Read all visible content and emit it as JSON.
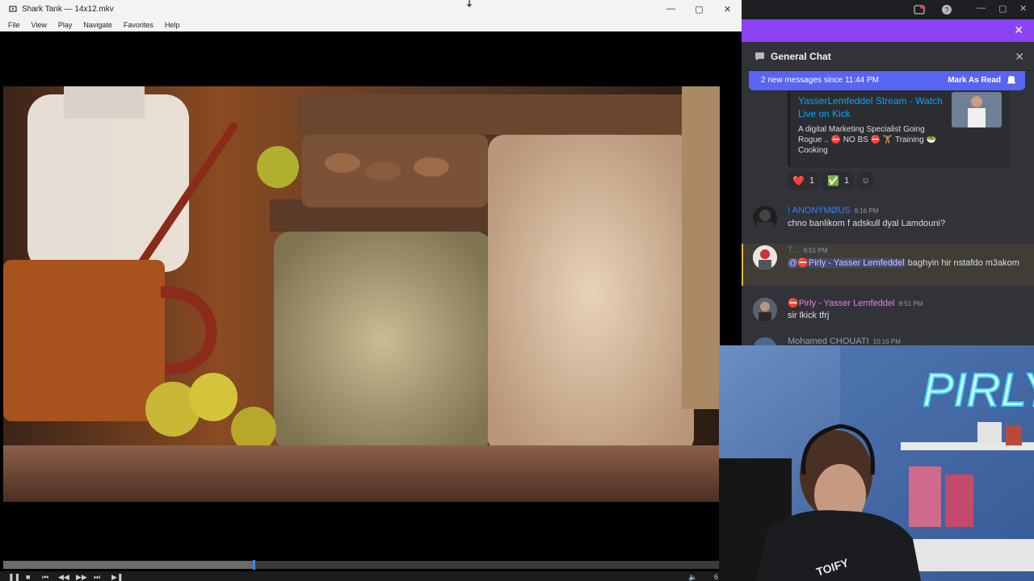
{
  "player": {
    "title": "Shark Tank — 14x12.mkv",
    "menu": [
      "File",
      "View",
      "Play",
      "Navigate",
      "Favorites",
      "Help"
    ],
    "window_buttons": {
      "minimize": "—",
      "maximize": "▢",
      "close": "✕"
    },
    "seek_progress": 0.35,
    "controls": {
      "pause": "❚❚",
      "stop": "■",
      "prev": "⏮",
      "rewind": "◀◀",
      "forward": "▶▶",
      "next": "⏭",
      "frame_step": "▶❚",
      "volume": "🔈",
      "volume_text": "6"
    }
  },
  "chat": {
    "banner_close": "✕",
    "header": {
      "title": "General Chat",
      "close": "✕"
    },
    "new_messages": {
      "text": "2 new messages since 11:44 PM",
      "action": "Mark As Read"
    },
    "embed": {
      "title": "YasserLemfeddel Stream - Watch Live on Kick",
      "description": "A digital Marketing Specialist Going Rogue .. ⛔ NO BS ⛔ 🏋 Training 🥗 Cooking"
    },
    "reactions": [
      {
        "glyph": "❤️",
        "count": "1"
      },
      {
        "glyph": "✅",
        "count": "1"
      },
      {
        "glyph": "☺",
        "count": ""
      }
    ],
    "messages": [
      {
        "author": "! ANONŸMØUS",
        "time": "9:16 PM",
        "text": "chno banlikom f adskull dyal Lamdouni?",
        "author_color": "#3b82f6"
      },
      {
        "author": "T...",
        "time": "9:51 PM",
        "mention": "@⛔Pirly - Yasser Lemfeddel",
        "text": " baghyin hir nstafdo m3akom",
        "author_color": "#6d6f78"
      },
      {
        "author": "⛔Pirly - Yasser Lemfeddel",
        "time": "9:51 PM",
        "text": "sir lkick tfrj",
        "author_color": "#e879f9"
      },
      {
        "author": "Mohamed CHOUATI",
        "time": "10:16 PM",
        "text": "",
        "author_color": "#8fa3b8"
      }
    ]
  },
  "webcam": {
    "neon_text": "PIRLY",
    "hoodie_text": "TOIFY"
  },
  "colors": {
    "chat_bg": "#313338",
    "blurple": "#5865f2",
    "banner": "#8c42f5",
    "link": "#00a8fc"
  }
}
